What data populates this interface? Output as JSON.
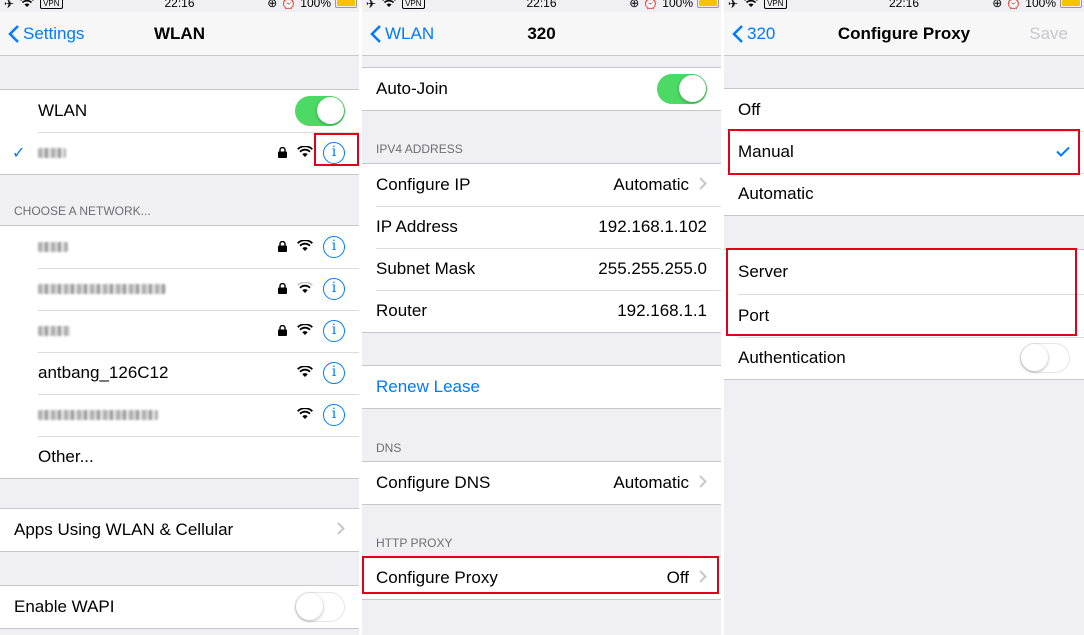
{
  "status": {
    "time": "22:16",
    "battery": "100%",
    "vpn": "VPN"
  },
  "panel1": {
    "back": "Settings",
    "title": "WLAN",
    "wlan_label": "WLAN",
    "choose_header": "CHOOSE A NETWORK...",
    "networks": [
      {
        "name": "antbang_126C12"
      }
    ],
    "other": "Other...",
    "apps_label": "Apps Using WLAN & Cellular",
    "wapi_label": "Enable WAPI"
  },
  "panel2": {
    "back": "WLAN",
    "title": "320",
    "auto_join": "Auto-Join",
    "ipv4_header": "IPV4 ADDRESS",
    "configure_ip": "Configure IP",
    "configure_ip_val": "Automatic",
    "ip_label": "IP Address",
    "ip_val": "192.168.1.102",
    "subnet_label": "Subnet Mask",
    "subnet_val": "255.255.255.0",
    "router_label": "Router",
    "router_val": "192.168.1.1",
    "renew": "Renew Lease",
    "dns_header": "DNS",
    "configure_dns": "Configure DNS",
    "configure_dns_val": "Automatic",
    "proxy_header": "HTTP PROXY",
    "configure_proxy": "Configure Proxy",
    "configure_proxy_val": "Off"
  },
  "panel3": {
    "back": "320",
    "title": "Configure Proxy",
    "save": "Save",
    "off": "Off",
    "manual": "Manual",
    "automatic": "Automatic",
    "server": "Server",
    "port": "Port",
    "authentication": "Authentication"
  },
  "colors": {
    "accent": "#007aff",
    "toggle_on": "#4cd964",
    "highlight": "#e0001a"
  }
}
